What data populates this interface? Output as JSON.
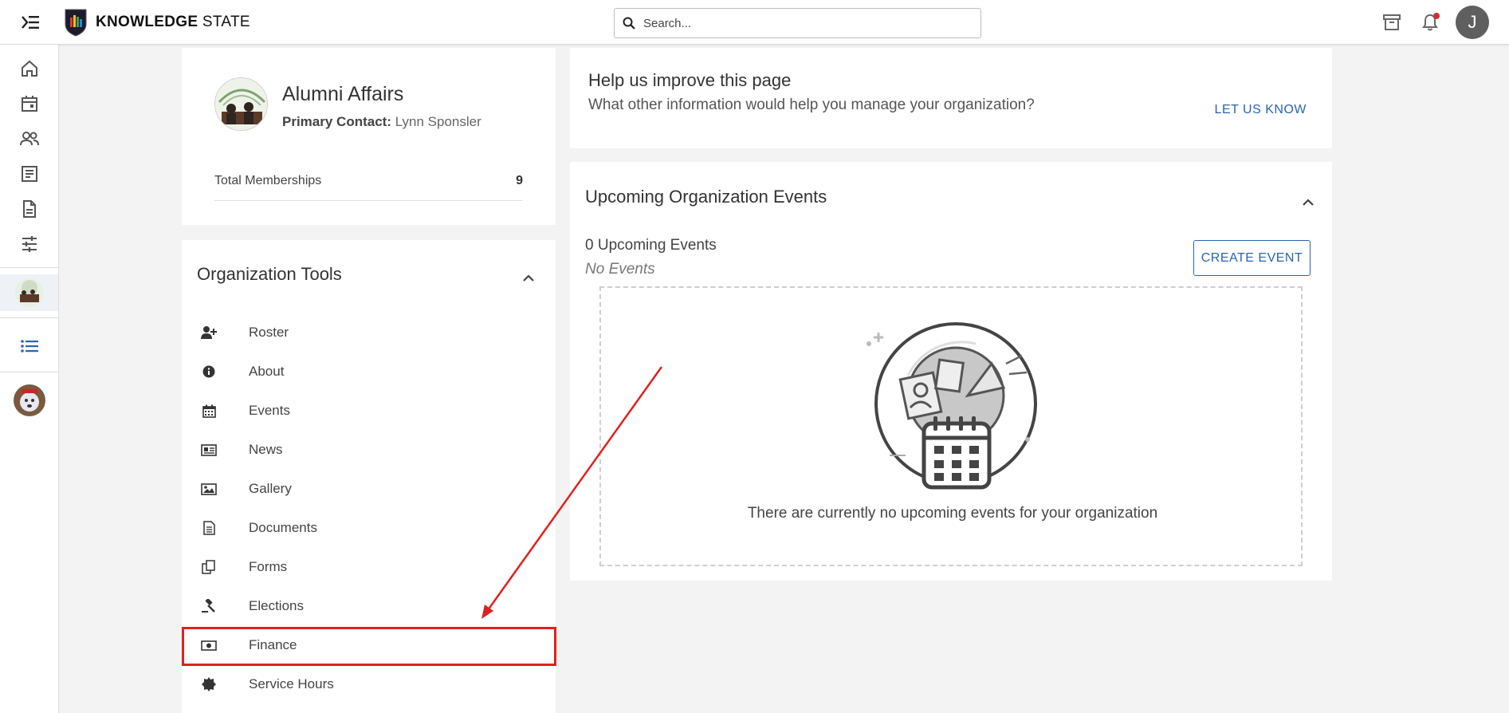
{
  "topbar": {
    "brand_bold": "KNOWLEDGE",
    "brand_light": "STATE",
    "search_placeholder": "Search...",
    "user_initial": "J"
  },
  "colors": {
    "accent_blue": "#2a64b0",
    "highlight_red": "#e02020",
    "notification_red": "#d32f2f"
  },
  "rail": {
    "icons": [
      "home-icon",
      "calendar-icon",
      "people-icon",
      "article-icon",
      "document-icon",
      "sliders-icon",
      "organization-avatar",
      "list-icon",
      "user-avatar"
    ]
  },
  "profile": {
    "org_name": "Alumni Affairs",
    "primary_contact_label": "Primary Contact:",
    "primary_contact_name": "Lynn Sponsler",
    "memberships_label": "Total Memberships",
    "memberships_count": "9"
  },
  "tools": {
    "title": "Organization Tools",
    "items": [
      {
        "label": "Roster",
        "icon": "user-plus-icon"
      },
      {
        "label": "About",
        "icon": "info-icon"
      },
      {
        "label": "Events",
        "icon": "calendar-icon"
      },
      {
        "label": "News",
        "icon": "newspaper-icon"
      },
      {
        "label": "Gallery",
        "icon": "image-icon"
      },
      {
        "label": "Documents",
        "icon": "file-text-icon"
      },
      {
        "label": "Forms",
        "icon": "forms-icon"
      },
      {
        "label": "Elections",
        "icon": "gavel-icon"
      },
      {
        "label": "Finance",
        "icon": "money-icon"
      },
      {
        "label": "Service Hours",
        "icon": "badge-icon"
      }
    ]
  },
  "help": {
    "title": "Help us improve this page",
    "subtitle": "What other information would help you manage your organization?",
    "link": "LET US KNOW"
  },
  "events": {
    "title": "Upcoming Organization Events",
    "upcoming_count": "0 Upcoming Events",
    "no_events": "No Events",
    "create_button": "CREATE EVENT",
    "empty_message": "There are currently no upcoming events for your organization"
  }
}
